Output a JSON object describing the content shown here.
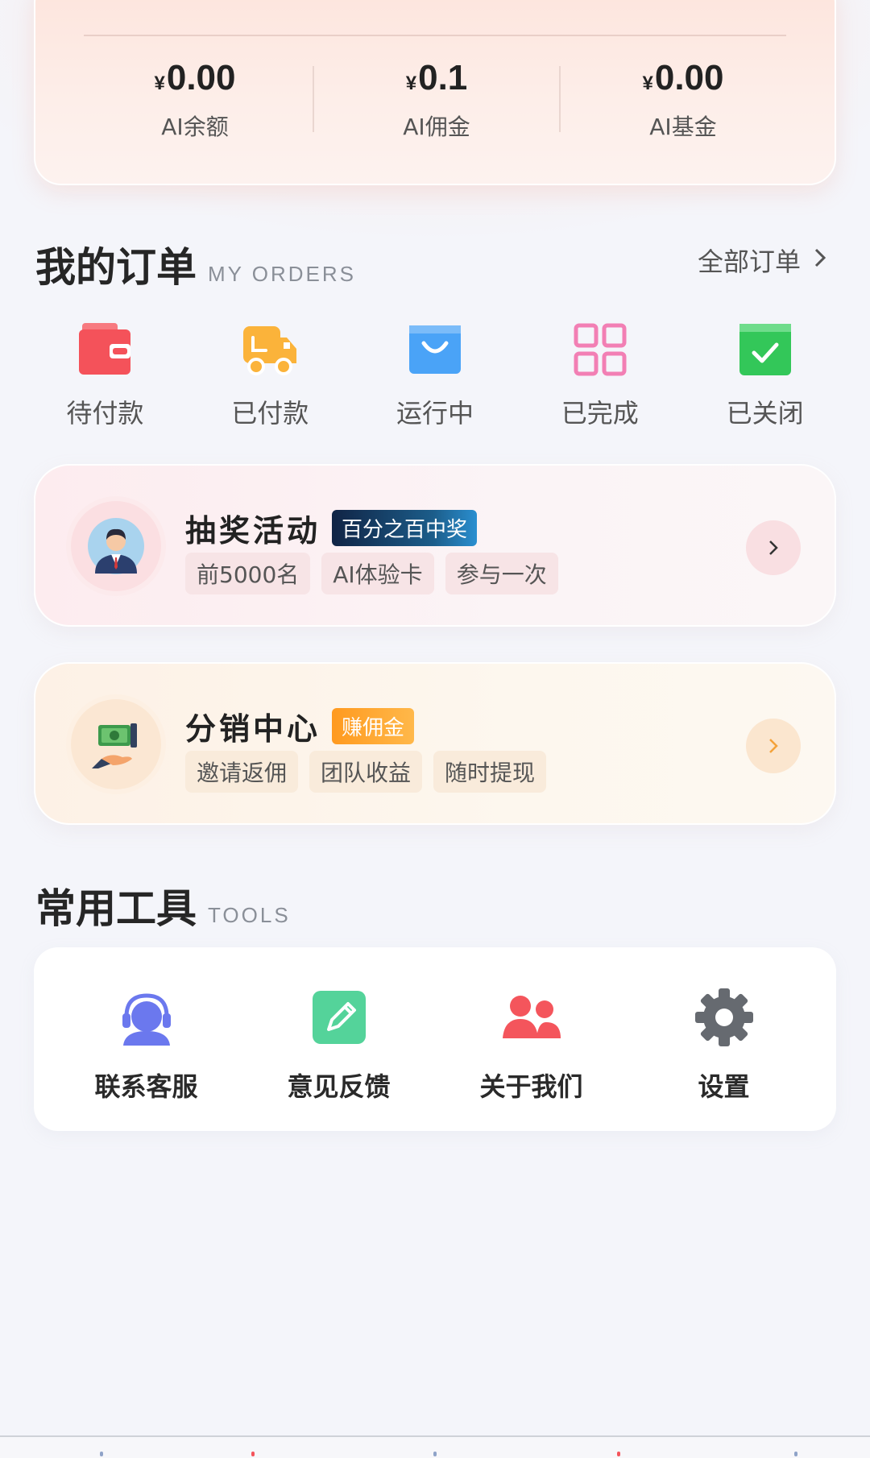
{
  "wallet": {
    "currency_symbol": "¥",
    "items": [
      {
        "amount": "0.00",
        "label": "AI余额"
      },
      {
        "amount": "0.1",
        "label": "AI佣金"
      },
      {
        "amount": "0.00",
        "label": "AI基金"
      }
    ]
  },
  "orders": {
    "title": "我的订单",
    "title_en": "MY ORDERS",
    "all_link": "全部订单",
    "items": [
      {
        "label": "待付款",
        "icon": "wallet-icon"
      },
      {
        "label": "已付款",
        "icon": "delivery-truck-icon"
      },
      {
        "label": "运行中",
        "icon": "shopping-bag-icon"
      },
      {
        "label": "已完成",
        "icon": "grid-icon"
      },
      {
        "label": "已关闭",
        "icon": "check-box-icon"
      }
    ]
  },
  "lottery": {
    "title": "抽奖活动",
    "badge": "百分之百中奖",
    "tags": [
      "前5000名",
      "AI体验卡",
      "参与一次"
    ]
  },
  "distribution": {
    "title": "分销中心",
    "badge": "赚佣金",
    "tags": [
      "邀请返佣",
      "团队收益",
      "随时提现"
    ]
  },
  "tools": {
    "title": "常用工具",
    "title_en": "TOOLS",
    "items": [
      {
        "label": "联系客服",
        "icon": "customer-service-icon"
      },
      {
        "label": "意见反馈",
        "icon": "feedback-edit-icon"
      },
      {
        "label": "关于我们",
        "icon": "users-icon"
      },
      {
        "label": "设置",
        "icon": "gear-icon"
      }
    ]
  },
  "colors": {
    "wallet_red": "#f4525a",
    "truck_orange": "#fbb33a",
    "bag_blue": "#4aa3f7",
    "grid_pink": "#f27fb4",
    "check_green": "#33c759",
    "service_purple": "#6b78ee",
    "feedback_green": "#54d39a",
    "users_red": "#f4555c",
    "gear_gray": "#666a70"
  }
}
